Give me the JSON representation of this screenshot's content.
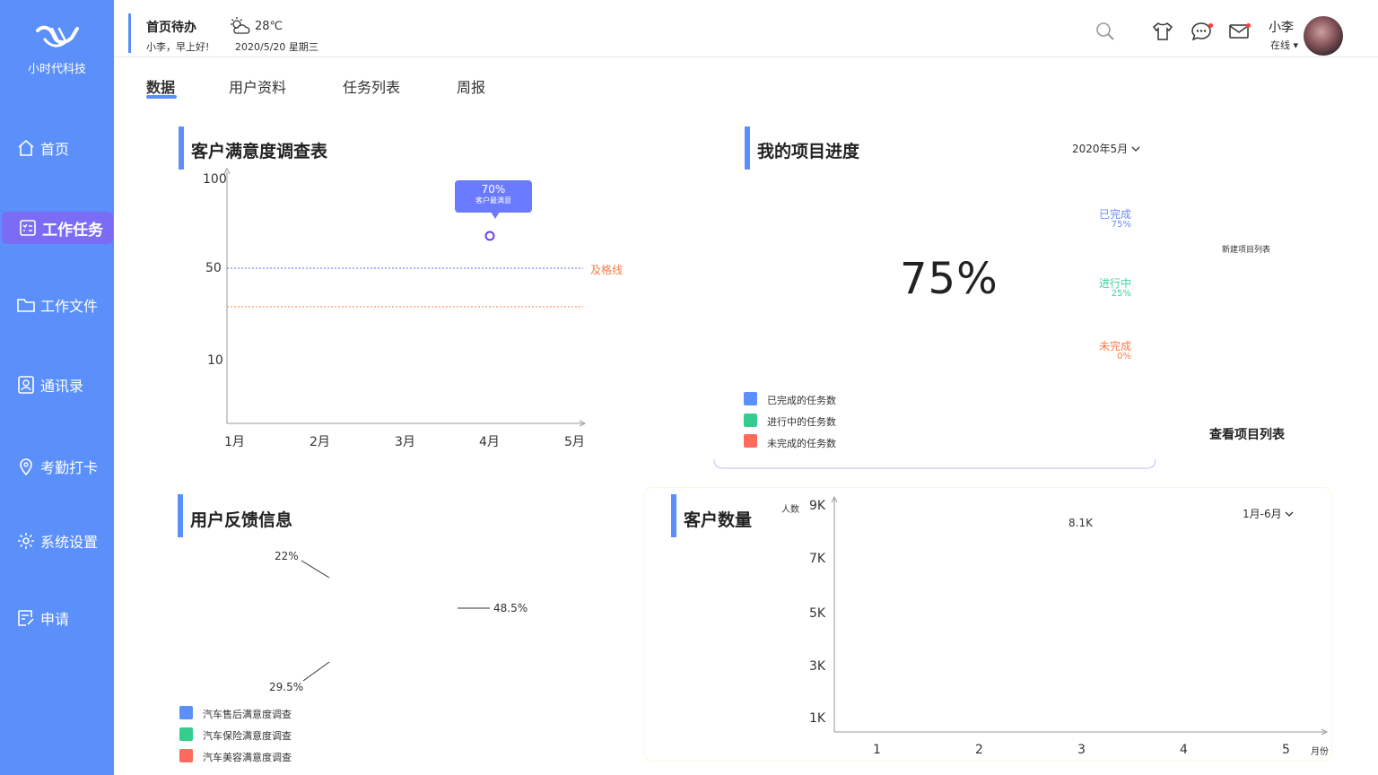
{
  "sidebar": {
    "brand": "小时代科技",
    "items": [
      {
        "label": "首页"
      },
      {
        "label": "工作任务"
      },
      {
        "label": "工作文件"
      },
      {
        "label": "通讯录"
      },
      {
        "label": "考勤打卡"
      },
      {
        "label": "系统设置"
      },
      {
        "label": "申请"
      }
    ]
  },
  "header": {
    "todo_title": "首页待办",
    "greeting": "小李，早上好!",
    "temperature": "28℃",
    "date": "2020/5/20 星期三",
    "user_name": "小李",
    "user_status": "在线",
    "status_caret": "▾"
  },
  "tabs": [
    {
      "label": "数据"
    },
    {
      "label": "用户资料"
    },
    {
      "label": "任务列表"
    },
    {
      "label": "周报"
    }
  ],
  "satisfaction": {
    "title": "客户满意度调查表",
    "y_ticks": [
      "100",
      "50",
      "10"
    ],
    "x_ticks": [
      "1月",
      "2月",
      "3月",
      "4月",
      "5月"
    ],
    "pass_line_label": "及格线",
    "tooltip_value": "70%",
    "tooltip_caption": "客户最满意"
  },
  "project": {
    "title": "我的项目进度",
    "month_select": "2020年5月",
    "center_value": "75%",
    "statuses": [
      {
        "label": "已完成",
        "percent": "75%",
        "color": "#6a8cf7"
      },
      {
        "label": "进行中",
        "percent": "25%",
        "color": "#3fd69a"
      },
      {
        "label": "未完成",
        "percent": "0%",
        "color": "#ff7a45"
      }
    ],
    "legend": [
      {
        "label": "已完成的任务数",
        "color": "#5b8ff9"
      },
      {
        "label": "进行中的任务数",
        "color": "#36cc8f"
      },
      {
        "label": "未完成的任务数",
        "color": "#fe6a5c"
      }
    ],
    "new_list_label": "新建项目列表",
    "view_list_link": "查看项目列表"
  },
  "feedback": {
    "title": "用户反馈信息",
    "labels": [
      "22%",
      "48.5%",
      "29.5%"
    ],
    "legend": [
      {
        "label": "汽车售后满意度调查",
        "color": "#5b8ff9"
      },
      {
        "label": "汽车保险满意度调查",
        "color": "#36cc8f"
      },
      {
        "label": "汽车美容满意度调查",
        "color": "#fe6a5c"
      }
    ]
  },
  "customers": {
    "title": "客户数量",
    "y_unit": "人数",
    "y_ticks": [
      "9K",
      "7K",
      "5K",
      "3K",
      "1K"
    ],
    "x_ticks": [
      "1",
      "2",
      "3",
      "4",
      "5"
    ],
    "x_unit": "月份",
    "range_select": "1月-6月",
    "peak_label": "8.1K"
  }
}
